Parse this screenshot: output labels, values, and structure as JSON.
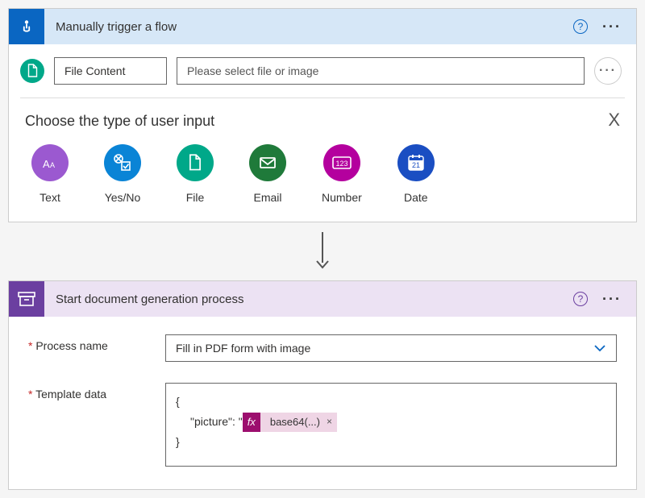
{
  "trigger": {
    "title": "Manually trigger a flow",
    "param_name": "File Content",
    "param_desc": "Please select file or image",
    "panel_title": "Choose the type of user input",
    "types": {
      "text": "Text",
      "yesno": "Yes/No",
      "file": "File",
      "email": "Email",
      "number": "Number",
      "date": "Date"
    }
  },
  "action": {
    "title": "Start document generation process",
    "labels": {
      "process_name": "Process name",
      "template_data": "Template data"
    },
    "process_name_value": "Fill in PDF form with image",
    "template_open": "{",
    "template_key": "\"picture\": \"",
    "template_close": "}",
    "expr_prefix": "fx",
    "expr_text": "base64(...)"
  },
  "glyphs": {
    "help": "?",
    "dots": "···",
    "close": "X",
    "chevron": "⌄",
    "token_x": "×",
    "date_day": "21",
    "number_123": "123"
  }
}
